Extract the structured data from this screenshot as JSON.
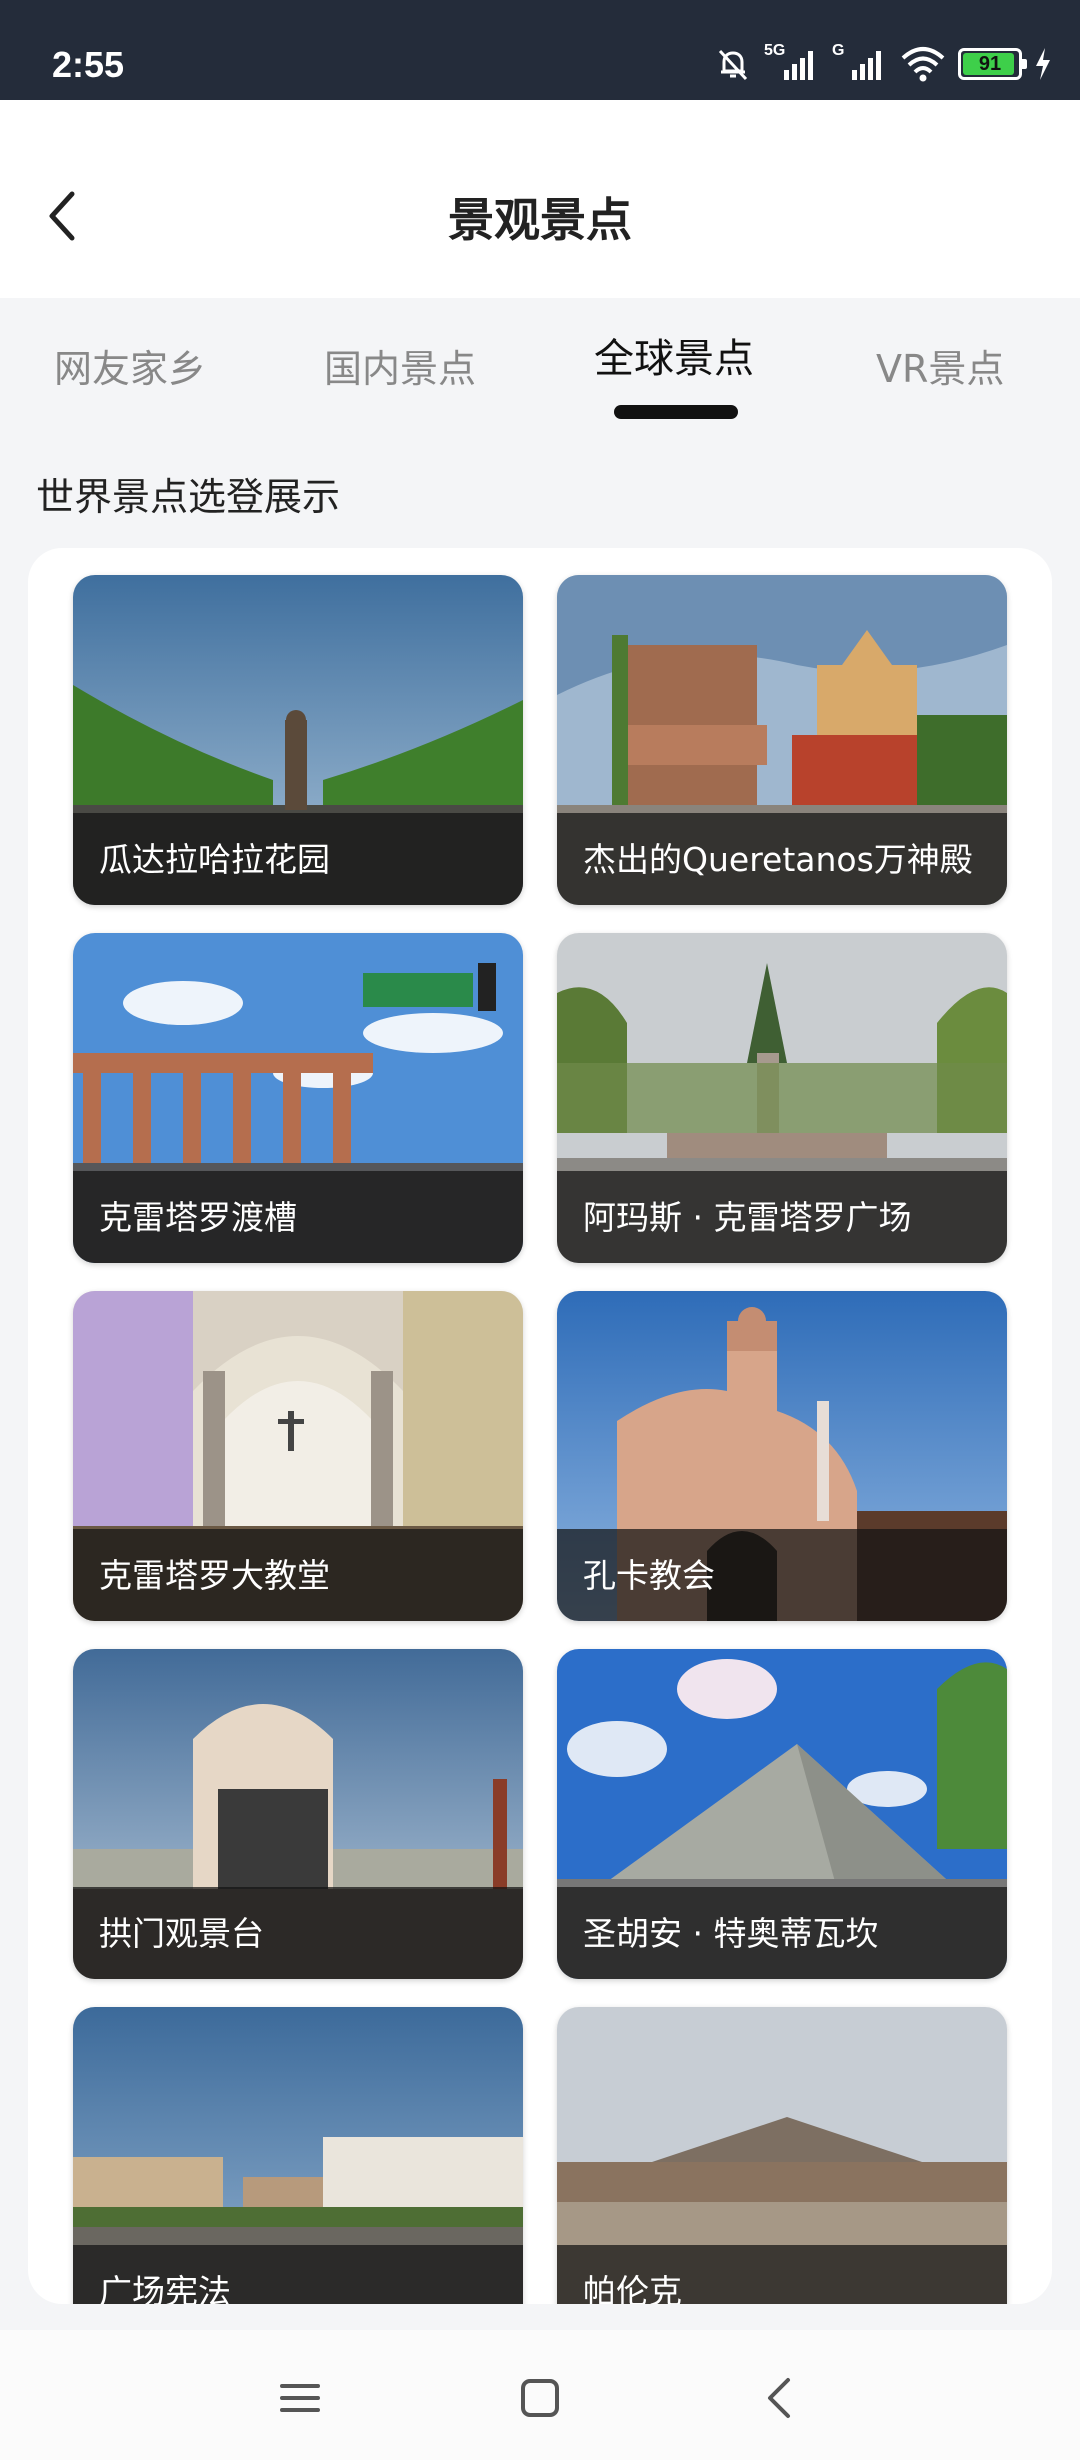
{
  "status_bar": {
    "time": "2:55",
    "network_1": "5G",
    "network_2": "G",
    "battery": "91",
    "colors": {
      "background": "#242c3a",
      "battery_fill": "#3ecf4a"
    }
  },
  "header": {
    "title": "景观景点",
    "back_icon": "chevron-left-icon"
  },
  "tabs": [
    {
      "label": "网友家乡",
      "active": false
    },
    {
      "label": "国内景点",
      "active": false
    },
    {
      "label": "全球景点",
      "active": true
    },
    {
      "label": "VR景点",
      "active": false
    }
  ],
  "section": {
    "title": "世界景点选登展示"
  },
  "spots": [
    {
      "name": "瓜达拉哈拉花园"
    },
    {
      "name": "杰出的Queretanos万神殿"
    },
    {
      "name": "克雷塔罗渡槽"
    },
    {
      "name": "阿玛斯 · 克雷塔罗广场"
    },
    {
      "name": "克雷塔罗大教堂"
    },
    {
      "name": "孔卡教会"
    },
    {
      "name": "拱门观景台"
    },
    {
      "name": "圣胡安 · 特奥蒂瓦坎"
    },
    {
      "name": "广场宪法"
    },
    {
      "name": "帕伦克"
    }
  ],
  "nav_bar": {
    "menu_icon": "menu-icon",
    "home_icon": "home-square-icon",
    "back_icon": "back-triangle-icon"
  }
}
